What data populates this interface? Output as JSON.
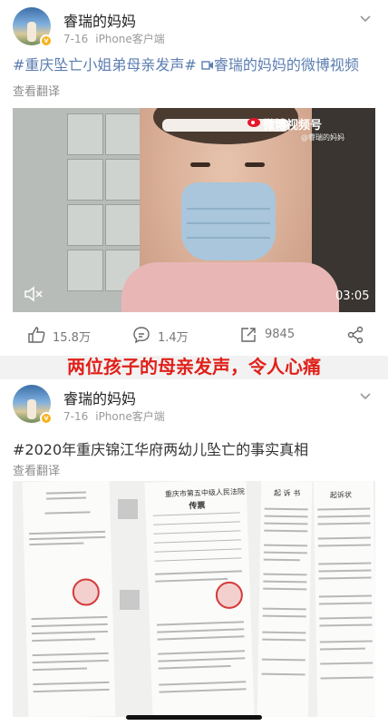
{
  "posts": [
    {
      "username": "睿瑞的妈妈",
      "date": "7-16",
      "client": "iPhone客户端",
      "content_tag1": "#重庆坠亡小姐弟母亲发声#",
      "content_link": "睿瑞的妈妈的微博视频",
      "translate": "查看翻译",
      "video": {
        "watermark": "微博视频号",
        "watermark_sub": "@睿瑞的妈妈",
        "duration": "03:05",
        "mute_icon": "mute-icon"
      },
      "actions": {
        "reposts": "15.8万",
        "comments": "1.4万",
        "likes": "9845"
      }
    },
    {
      "username": "睿瑞的妈妈",
      "date": "7-16",
      "client": "iPhone客户端",
      "content": "#2020年重庆锦江华府两幼儿坠亡的事实真相",
      "translate": "查看翻译",
      "doc2_title": "重庆市第五中级人民法院",
      "doc2_subtitle": "传票",
      "doc3_title": "起 诉 书",
      "doc4_title": "起诉状"
    }
  ],
  "overlay_caption": "两位孩子的母亲发声，令人心痛",
  "colors": {
    "link": "#5b7db1",
    "caption_red": "#e0201a",
    "badge": "#f9b21b"
  }
}
